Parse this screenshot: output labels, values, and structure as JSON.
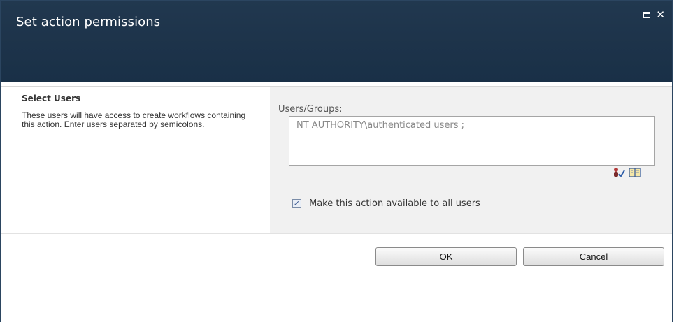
{
  "dialog": {
    "title": "Set action permissions"
  },
  "section": {
    "title": "Select Users",
    "description": "These users will have access to create workflows containing this action. Enter users separated by semicolons.",
    "field_label": "Users/Groups:",
    "people_picker": {
      "resolved_user": "NT AUTHORITY\\authenticated users",
      "separator": " ;"
    },
    "checkbox": {
      "label": "Make this action available to all users",
      "checked": true,
      "mark": "✓"
    }
  },
  "buttons": {
    "ok_label": "OK",
    "cancel_label": "Cancel"
  },
  "icons": {
    "maximize": "maximize-icon",
    "close": "close-icon",
    "check_names": "check-names-icon",
    "browse": "address-book-icon"
  },
  "colors": {
    "titlebar": "#1d334a",
    "section_right_bg": "#f1f1f1",
    "border": "#a5a5a5"
  }
}
